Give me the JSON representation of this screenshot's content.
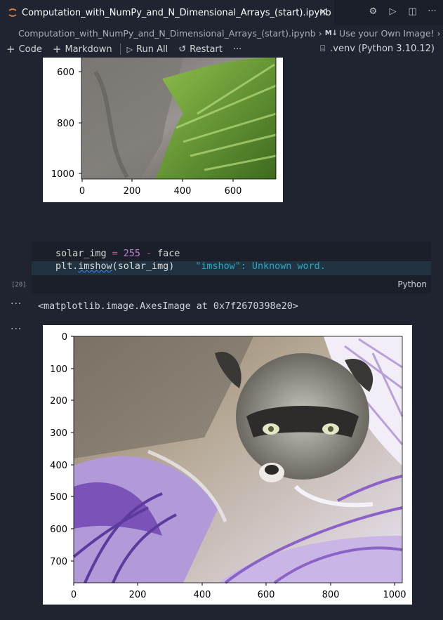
{
  "tab": {
    "title": "Computation_with_NumPy_and_N_Dimensional_Arrays_(start).ipynb",
    "close": "×"
  },
  "breadcrumb": {
    "file": "Computation_with_NumPy_and_N_Dimensional_Arrays_(start).ipynb",
    "md_badge": "M↓",
    "section": "Use your Own Image!"
  },
  "toolbar": {
    "code": "Code",
    "markdown": "Markdown",
    "run_all": "Run All",
    "restart": "Restart",
    "more": "···",
    "kernel": ".venv (Python 3.10.12)"
  },
  "figure_top": {
    "yticks": [
      "600",
      "800",
      "1000"
    ],
    "xticks": [
      "0",
      "200",
      "400",
      "600"
    ]
  },
  "cell": {
    "line1": {
      "var": "solar_img",
      "eq": " = ",
      "num": "255",
      "minus": " - ",
      "name": "face"
    },
    "line2": {
      "obj": "plt.",
      "fn": "imshow",
      "args": "(solar_img)",
      "hint": "\"imshow\": Unknown word."
    },
    "exec_count": "[20]",
    "language": "Python"
  },
  "output": {
    "dots": "···",
    "text": "<matplotlib.image.AxesImage at 0x7f2670398e20>"
  },
  "figure_bottom": {
    "yticks": [
      "0",
      "100",
      "200",
      "300",
      "400",
      "500",
      "600",
      "700"
    ],
    "xticks": [
      "0",
      "200",
      "400",
      "600",
      "800",
      "1000"
    ]
  }
}
